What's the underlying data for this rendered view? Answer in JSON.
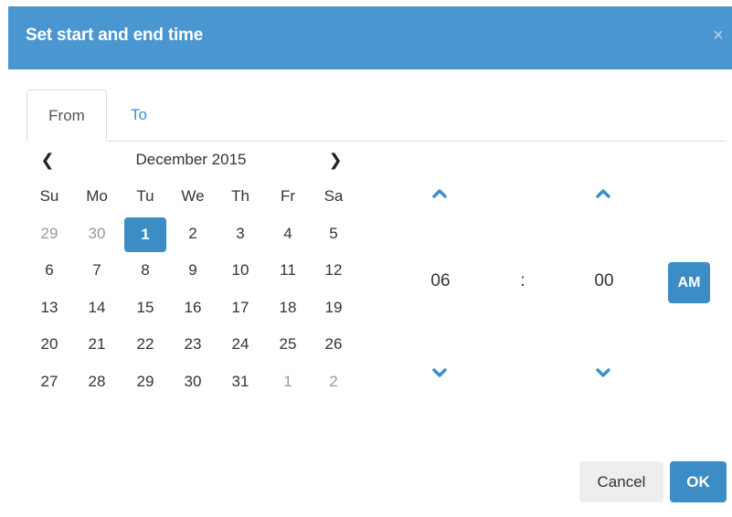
{
  "dialog": {
    "title": "Set start and end time",
    "close_label": "×"
  },
  "tabs": [
    {
      "label": "From",
      "active": true
    },
    {
      "label": "To",
      "active": false
    }
  ],
  "calendar": {
    "prev_label": "❮",
    "next_label": "❯",
    "month_label": "December 2015",
    "weekdays": [
      "Su",
      "Mo",
      "Tu",
      "We",
      "Th",
      "Fr",
      "Sa"
    ],
    "weeks": [
      [
        {
          "d": "29",
          "muted": true
        },
        {
          "d": "30",
          "muted": true
        },
        {
          "d": "1",
          "selected": true
        },
        {
          "d": "2"
        },
        {
          "d": "3"
        },
        {
          "d": "4"
        },
        {
          "d": "5"
        }
      ],
      [
        {
          "d": "6"
        },
        {
          "d": "7"
        },
        {
          "d": "8"
        },
        {
          "d": "9"
        },
        {
          "d": "10"
        },
        {
          "d": "11"
        },
        {
          "d": "12"
        }
      ],
      [
        {
          "d": "13"
        },
        {
          "d": "14"
        },
        {
          "d": "15"
        },
        {
          "d": "16"
        },
        {
          "d": "17"
        },
        {
          "d": "18"
        },
        {
          "d": "19"
        }
      ],
      [
        {
          "d": "20"
        },
        {
          "d": "21"
        },
        {
          "d": "22"
        },
        {
          "d": "23"
        },
        {
          "d": "24"
        },
        {
          "d": "25"
        },
        {
          "d": "26"
        }
      ],
      [
        {
          "d": "27"
        },
        {
          "d": "28"
        },
        {
          "d": "29"
        },
        {
          "d": "30"
        },
        {
          "d": "31"
        },
        {
          "d": "1",
          "muted": true
        },
        {
          "d": "2",
          "muted": true
        }
      ]
    ]
  },
  "time": {
    "hour": "06",
    "separator": ":",
    "minute": "00",
    "period": "AM"
  },
  "footer": {
    "cancel_label": "Cancel",
    "ok_label": "OK"
  },
  "colors": {
    "header": "#4a96d0",
    "accent": "#3c8dc5"
  }
}
